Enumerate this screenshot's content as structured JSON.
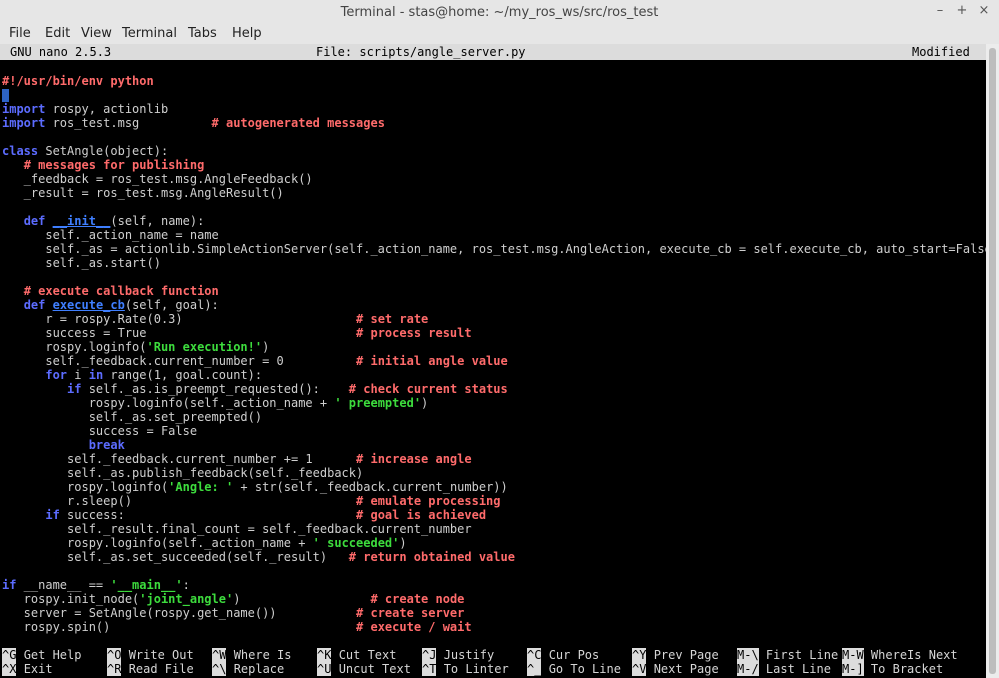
{
  "window": {
    "title": "Terminal - stas@home: ~/my_ros_ws/src/ros_test",
    "buttons": {
      "minimize": "–",
      "maximize": "+",
      "close": "×"
    }
  },
  "menu": [
    "File",
    "Edit",
    "View",
    "Terminal",
    "Tabs",
    "Help"
  ],
  "nano": {
    "version": "GNU nano 2.5.3",
    "file": "File: scripts/angle_server.py",
    "status": "Modified"
  },
  "code_lines": [
    {
      "row": 0,
      "segs": [
        {
          "t": "#!/usr/bin/env python",
          "c": "cmt"
        }
      ]
    },
    {
      "row": 1,
      "segs": [
        {
          "t": "",
          "c": "cursor"
        }
      ]
    },
    {
      "row": 2,
      "segs": [
        {
          "t": "import",
          "c": "kw"
        },
        {
          "t": " rospy, actionlib"
        }
      ]
    },
    {
      "row": 3,
      "segs": [
        {
          "t": "import",
          "c": "kw"
        },
        {
          "t": " ros_test.msg          "
        },
        {
          "t": "# autogenerated messages",
          "c": "cmt"
        }
      ]
    },
    {
      "row": 5,
      "segs": [
        {
          "t": "class",
          "c": "kw"
        },
        {
          "t": " SetAngle(object):"
        }
      ]
    },
    {
      "row": 6,
      "segs": [
        {
          "t": "   "
        },
        {
          "t": "# messages for publishing",
          "c": "cmt"
        }
      ]
    },
    {
      "row": 7,
      "segs": [
        {
          "t": "   _feedback = ros_test.msg.AngleFeedback()"
        }
      ]
    },
    {
      "row": 8,
      "segs": [
        {
          "t": "   _result = ros_test.msg.AngleResult()"
        }
      ]
    },
    {
      "row": 10,
      "segs": [
        {
          "t": "   "
        },
        {
          "t": "def",
          "c": "kw"
        },
        {
          "t": " "
        },
        {
          "t": "__init__",
          "c": "def"
        },
        {
          "t": "(self, name):"
        }
      ]
    },
    {
      "row": 11,
      "segs": [
        {
          "t": "      self._action_name = name"
        }
      ]
    },
    {
      "row": 12,
      "segs": [
        {
          "t": "      self._as = actionlib.SimpleActionServer(self._action_name, ros_test.msg.AngleAction, execute_cb = self.execute_cb, auto_start=False)"
        }
      ]
    },
    {
      "row": 13,
      "segs": [
        {
          "t": "      self._as.start()"
        }
      ]
    },
    {
      "row": 15,
      "segs": [
        {
          "t": "   "
        },
        {
          "t": "# execute callback function",
          "c": "cmt"
        }
      ]
    },
    {
      "row": 16,
      "segs": [
        {
          "t": "   "
        },
        {
          "t": "def",
          "c": "kw"
        },
        {
          "t": " "
        },
        {
          "t": "execute_cb",
          "c": "def"
        },
        {
          "t": "(self, goal):"
        }
      ]
    },
    {
      "row": 17,
      "segs": [
        {
          "t": "      r = rospy.Rate(0.3)                        "
        },
        {
          "t": "# set rate",
          "c": "cmt"
        }
      ]
    },
    {
      "row": 18,
      "segs": [
        {
          "t": "      success = True                             "
        },
        {
          "t": "# process result",
          "c": "cmt"
        }
      ]
    },
    {
      "row": 19,
      "segs": [
        {
          "t": "      rospy.loginfo("
        },
        {
          "t": "'Run execution!'",
          "c": "str"
        },
        {
          "t": ")"
        }
      ]
    },
    {
      "row": 20,
      "segs": [
        {
          "t": "      self._feedback.current_number = 0          "
        },
        {
          "t": "# initial angle value",
          "c": "cmt"
        }
      ]
    },
    {
      "row": 21,
      "segs": [
        {
          "t": "      "
        },
        {
          "t": "for",
          "c": "kw"
        },
        {
          "t": " i "
        },
        {
          "t": "in",
          "c": "kw"
        },
        {
          "t": " range(1, goal.count):"
        }
      ]
    },
    {
      "row": 22,
      "segs": [
        {
          "t": "         "
        },
        {
          "t": "if",
          "c": "kw"
        },
        {
          "t": " self._as.is_preempt_requested():    "
        },
        {
          "t": "# check current status",
          "c": "cmt"
        }
      ]
    },
    {
      "row": 23,
      "segs": [
        {
          "t": "            rospy.loginfo(self._action_name + "
        },
        {
          "t": "' preempted'",
          "c": "str"
        },
        {
          "t": ")"
        }
      ]
    },
    {
      "row": 24,
      "segs": [
        {
          "t": "            self._as.set_preempted()"
        }
      ]
    },
    {
      "row": 25,
      "segs": [
        {
          "t": "            success = False"
        }
      ]
    },
    {
      "row": 26,
      "segs": [
        {
          "t": "            "
        },
        {
          "t": "break",
          "c": "kw"
        }
      ]
    },
    {
      "row": 27,
      "segs": [
        {
          "t": "         self._feedback.current_number += 1      "
        },
        {
          "t": "# increase angle",
          "c": "cmt"
        }
      ]
    },
    {
      "row": 28,
      "segs": [
        {
          "t": "         self._as.publish_feedback(self._feedback)"
        }
      ]
    },
    {
      "row": 29,
      "segs": [
        {
          "t": "         rospy.loginfo("
        },
        {
          "t": "'Angle: '",
          "c": "str"
        },
        {
          "t": " + str(self._feedback.current_number))"
        }
      ]
    },
    {
      "row": 30,
      "segs": [
        {
          "t": "         r.sleep()                               "
        },
        {
          "t": "# emulate processing",
          "c": "cmt"
        }
      ]
    },
    {
      "row": 31,
      "segs": [
        {
          "t": "      "
        },
        {
          "t": "if",
          "c": "kw"
        },
        {
          "t": " success:                                "
        },
        {
          "t": "# goal is achieved",
          "c": "cmt"
        }
      ]
    },
    {
      "row": 32,
      "segs": [
        {
          "t": "         self._result.final_count = self._feedback.current_number"
        }
      ]
    },
    {
      "row": 33,
      "segs": [
        {
          "t": "         rospy.loginfo(self._action_name + "
        },
        {
          "t": "' succeeded'",
          "c": "str"
        },
        {
          "t": ")"
        }
      ]
    },
    {
      "row": 34,
      "segs": [
        {
          "t": "         self._as.set_succeeded(self._result)   "
        },
        {
          "t": "# return obtained value",
          "c": "cmt"
        }
      ]
    },
    {
      "row": 36,
      "segs": [
        {
          "t": "if",
          "c": "kw"
        },
        {
          "t": " __name__ == "
        },
        {
          "t": "'__main__'",
          "c": "str"
        },
        {
          "t": ":"
        }
      ]
    },
    {
      "row": 37,
      "segs": [
        {
          "t": "   rospy.init_node("
        },
        {
          "t": "'joint_angle'",
          "c": "str"
        },
        {
          "t": ")                  "
        },
        {
          "t": "# create node",
          "c": "cmt"
        }
      ]
    },
    {
      "row": 38,
      "segs": [
        {
          "t": "   server = SetAngle(rospy.get_name())           "
        },
        {
          "t": "# create server",
          "c": "cmt"
        }
      ]
    },
    {
      "row": 39,
      "segs": [
        {
          "t": "   rospy.spin()                                  "
        },
        {
          "t": "# execute / wait",
          "c": "cmt"
        }
      ]
    }
  ],
  "help": {
    "row1": [
      {
        "key": "^G",
        "label": "Get Help"
      },
      {
        "key": "^O",
        "label": "Write Out"
      },
      {
        "key": "^W",
        "label": "Where Is"
      },
      {
        "key": "^K",
        "label": "Cut Text"
      },
      {
        "key": "^J",
        "label": "Justify"
      },
      {
        "key": "^C",
        "label": "Cur Pos"
      },
      {
        "key": "^Y",
        "label": "Prev Page"
      },
      {
        "key": "M-\\",
        "label": "First Line"
      },
      {
        "key": "M-W",
        "label": "WhereIs Next"
      }
    ],
    "row2": [
      {
        "key": "^X",
        "label": "Exit"
      },
      {
        "key": "^R",
        "label": "Read File"
      },
      {
        "key": "^\\",
        "label": "Replace"
      },
      {
        "key": "^U",
        "label": "Uncut Text"
      },
      {
        "key": "^T",
        "label": "To Linter"
      },
      {
        "key": "^_",
        "label": "Go To Line"
      },
      {
        "key": "^V",
        "label": "Next Page"
      },
      {
        "key": "M-/",
        "label": "Last Line"
      },
      {
        "key": "M-]",
        "label": "To Bracket"
      }
    ]
  }
}
